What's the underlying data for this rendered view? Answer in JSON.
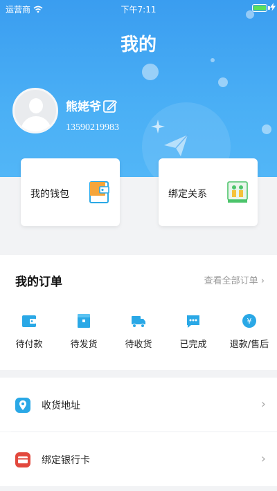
{
  "status_bar": {
    "carrier": "运营商",
    "time": "下午7:11"
  },
  "page": {
    "title": "我的"
  },
  "profile": {
    "name": "熊姥爷",
    "phone": "13590219983"
  },
  "cards": [
    {
      "label": "我的钱包",
      "icon": "wallet-icon"
    },
    {
      "label": "绑定关系",
      "icon": "binding-icon"
    }
  ],
  "orders": {
    "title": "我的订单",
    "see_all": "查看全部订单",
    "items": [
      {
        "label": "待付款",
        "icon": "pending-payment-icon"
      },
      {
        "label": "待发货",
        "icon": "pending-shipment-icon"
      },
      {
        "label": "待收货",
        "icon": "pending-receipt-icon"
      },
      {
        "label": "已完成",
        "icon": "completed-icon"
      },
      {
        "label": "退款/售后",
        "icon": "refund-icon"
      }
    ]
  },
  "menu": [
    {
      "label": "收货地址",
      "icon": "location-icon"
    },
    {
      "label": "绑定银行卡",
      "icon": "bank-card-icon"
    }
  ],
  "colors": {
    "header": "#3a9df0",
    "accent": "#2aa8e6",
    "card_icon_orange": "#f5a53b",
    "card_icon_green": "#4cc46b",
    "bank_red": "#e2483d"
  }
}
